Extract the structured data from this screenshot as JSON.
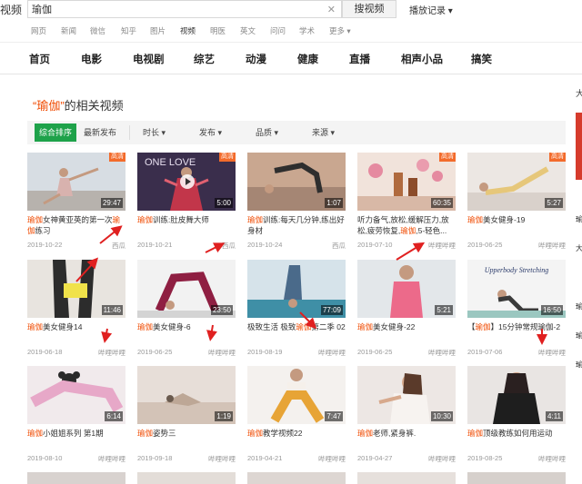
{
  "header": {
    "logo_fragment": "视频",
    "search_value": "瑜伽",
    "search_button": "搜视频",
    "history": "播放记录 ▾",
    "clear_icon": "close-icon"
  },
  "category_nav": [
    "网页",
    "新闻",
    "微信",
    "知乎",
    "图片",
    "视频",
    "明医",
    "英文",
    "问问",
    "学术",
    "更多 ▾"
  ],
  "main_nav": [
    "首页",
    "电影",
    "电视剧",
    "综艺",
    "动漫",
    "健康",
    "直播",
    "相声小品",
    "搞笑"
  ],
  "section": {
    "kw": "“瑜伽”",
    "rest": "的相关视频"
  },
  "filters": {
    "sort_active": "综合排序",
    "sort_new": "最新发布",
    "duration": "时长 ▾",
    "publish": "发布 ▾",
    "quality": "品质 ▾",
    "source": "来源 ▾"
  },
  "colors": {
    "accent_green": "#1ea24a",
    "keyword_red": "#f04a00",
    "hd_orange": "#f36b2b"
  },
  "cards": [
    {
      "kw": "瑜伽",
      "title": "女神黄亚英的第一次",
      "kw2": "瑜伽",
      "title2": "练习",
      "date": "2019-10-22",
      "src": "西瓜",
      "dur": "29:47",
      "hd": "高清"
    },
    {
      "kw": "瑜伽",
      "title": "训练:肚皮舞大师",
      "kw2": "",
      "title2": "",
      "date": "2019-10-21",
      "src": "西瓜",
      "dur": "5:00",
      "hd": "高清"
    },
    {
      "kw": "瑜伽",
      "title": "训练:每天几分钟,练出好身材",
      "kw2": "",
      "title2": "",
      "date": "2019-10-24",
      "src": "西瓜",
      "dur": "1:07",
      "hd": ""
    },
    {
      "kw": "",
      "title": "听力备气,放松,缓解压力,放松,疲劳恢复,",
      "kw2": "瑜伽",
      "title2": ",5-轻色...",
      "date": "2019-07-10",
      "src": "哔哩哔哩",
      "dur": "60:35",
      "hd": "高清"
    },
    {
      "kw": "瑜伽",
      "title": "美女健身-19",
      "kw2": "",
      "title2": "",
      "date": "2019-06-25",
      "src": "哔哩哔哩",
      "dur": "5:27",
      "hd": "高清"
    },
    {
      "kw": "瑜伽",
      "title": "美女健身14",
      "kw2": "",
      "title2": "",
      "date": "2019-06-18",
      "src": "哔哩哔哩",
      "dur": "11:46",
      "hd": ""
    },
    {
      "kw": "瑜伽",
      "title": "美女健身-6",
      "kw2": "",
      "title2": "",
      "date": "2019-06-25",
      "src": "哔哩哔哩",
      "dur": "23:50",
      "hd": ""
    },
    {
      "kw": "",
      "title": "极致生活 极致",
      "kw2": "瑜伽",
      "title2": "第二季 02",
      "date": "2019-08-19",
      "src": "哔哩哔哩",
      "dur": "77:09",
      "hd": ""
    },
    {
      "kw": "瑜伽",
      "title": "美女健身-22",
      "kw2": "",
      "title2": "",
      "date": "2019-06-25",
      "src": "哔哩哔哩",
      "dur": "5:21",
      "hd": ""
    },
    {
      "kw": "【",
      "title": "瑜伽",
      "kw2": "",
      "title2": "】15分钟常规瑜伽-2",
      "date": "2019-07-06",
      "src": "哔哩哔哩",
      "dur": "16:50",
      "hd": ""
    },
    {
      "kw": "瑜伽",
      "title": "小姐姐系列 第1期",
      "kw2": "",
      "title2": "",
      "date": "2019-08-10",
      "src": "哔哩哔哩",
      "dur": "6:14",
      "hd": ""
    },
    {
      "kw": "瑜伽",
      "title": "姿势三",
      "kw2": "",
      "title2": "",
      "date": "2019-09-18",
      "src": "哔哩哔哩",
      "dur": "1:19",
      "hd": ""
    },
    {
      "kw": "瑜伽",
      "title": "教学视频22",
      "kw2": "",
      "title2": "",
      "date": "2019-04-21",
      "src": "哔哩哔哩",
      "dur": "7:47",
      "hd": ""
    },
    {
      "kw": "瑜伽",
      "title": "老师,紧身裤.",
      "kw2": "",
      "title2": "",
      "date": "2019-04-27",
      "src": "哔哩哔哩",
      "dur": "10:30",
      "hd": ""
    },
    {
      "kw": "瑜伽",
      "title": "顶级教练如何用运动",
      "kw2": "",
      "title2": "",
      "date": "2019-08-25",
      "src": "哔哩哔哩",
      "dur": "4:11",
      "hd": ""
    }
  ],
  "thumb_text": {
    "card1": "ONE LOVE",
    "card9": "Upperbody Stretching"
  },
  "side_fragments": [
    "大",
    "相关",
    "瑜",
    "大",
    "瑜",
    "瑜",
    "瑜"
  ]
}
